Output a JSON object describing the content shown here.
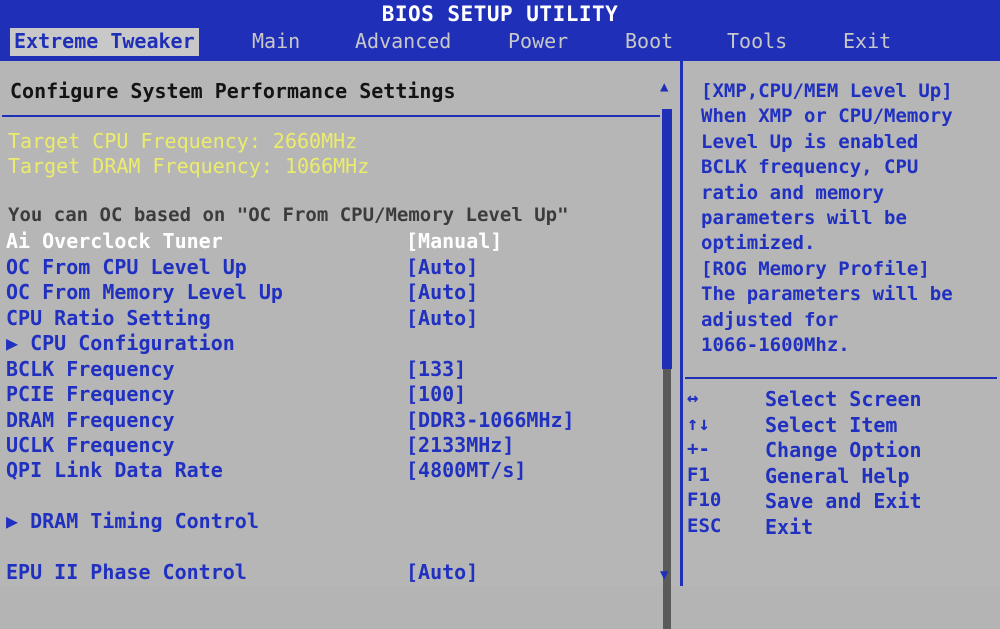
{
  "title": "BIOS SETUP UTILITY",
  "menu": [
    "Extreme Tweaker",
    "Main",
    "Advanced",
    "Power",
    "Boot",
    "Tools",
    "Exit"
  ],
  "heading": "Configure System Performance Settings",
  "target_cpu": "Target CPU Frequency: 2660MHz",
  "target_dram": "Target DRAM Frequency: 1066MHz",
  "note": "You can OC based on \"OC From CPU/Memory Level Up\"",
  "settings": [
    {
      "label": "Ai Overclock Tuner",
      "value": "[Manual]"
    },
    {
      "label": "OC From CPU Level Up",
      "value": "[Auto]"
    },
    {
      "label": "OC From Memory Level Up",
      "value": "[Auto]"
    },
    {
      "label": "CPU Ratio Setting",
      "value": "[Auto]"
    },
    {
      "label": "▶ CPU Configuration",
      "value": ""
    },
    {
      "label": "BCLK Frequency",
      "value": "[133]"
    },
    {
      "label": "PCIE Frequency",
      "value": "[100]"
    },
    {
      "label": "DRAM Frequency",
      "value": "[DDR3-1066MHz]"
    },
    {
      "label": "UCLK Frequency",
      "value": "[2133MHz]"
    },
    {
      "label": "QPI Link Data Rate",
      "value": "[4800MT/s]"
    },
    {
      "label": "▶ DRAM Timing Control",
      "value": ""
    },
    {
      "label": "EPU II Phase Control",
      "value": "[Auto]"
    }
  ],
  "help_lines": [
    "[XMP,CPU/MEM Level Up]",
    "When XMP or CPU/Memory",
    "Level Up is enabled",
    "BCLK frequency, CPU",
    "ratio and memory",
    "parameters will be",
    "optimized.",
    "[ROG Memory Profile]",
    "The parameters will be",
    "adjusted for",
    "1066-1600Mhz."
  ],
  "keys": [
    {
      "key": "↔",
      "desc": "Select Screen"
    },
    {
      "key": "↑↓",
      "desc": "Select Item"
    },
    {
      "key": "+-",
      "desc": "Change Option"
    },
    {
      "key": "F1",
      "desc": "General Help"
    },
    {
      "key": "F10",
      "desc": "Save and Exit"
    },
    {
      "key": "ESC",
      "desc": "Exit"
    }
  ],
  "colors": {
    "blue": "#1f2fb8",
    "background": "#b6b6b6",
    "yellow": "#ecec6c",
    "selected": "#ffffff"
  }
}
